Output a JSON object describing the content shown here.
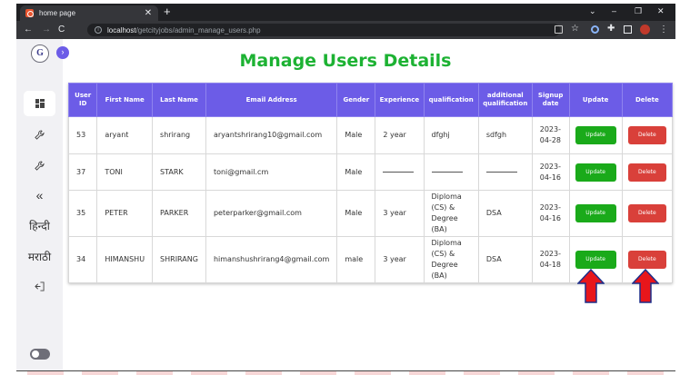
{
  "browser": {
    "tab_title": "home page",
    "url_host": "localhost",
    "url_path": "/getcityjobs/admin_manage_users.php"
  },
  "sidebar": {
    "logo_text": "G",
    "items": [
      {
        "icon": "dashboard-icon"
      },
      {
        "icon": "wrench-icon"
      },
      {
        "icon": "wrench-icon"
      },
      {
        "icon": "double-chevron-left-icon",
        "label": "«"
      },
      {
        "label": "हिन्दी"
      },
      {
        "label": "मराठी"
      },
      {
        "icon": "logout-icon"
      }
    ]
  },
  "page": {
    "title": "Manage Users Details"
  },
  "table": {
    "headers": [
      "User ID",
      "First Name",
      "Last Name",
      "Email Address",
      "Gender",
      "Experience",
      "qualification",
      "additional qualification",
      "Signup date",
      "Update",
      "Delete"
    ],
    "rows": [
      {
        "id": "53",
        "first": "aryant",
        "last": "shrirang",
        "email": "aryantshrirang10@gmail.com",
        "gender": "Male",
        "experience": "2 year",
        "qualification": "dfghj",
        "additional": "sdfgh",
        "signup": "2023-04-28"
      },
      {
        "id": "37",
        "first": "TONI",
        "last": "STARK",
        "email": "toni@gmail.cm",
        "gender": "Male",
        "experience": "",
        "qualification": "",
        "additional": "",
        "signup": "2023-04-16"
      },
      {
        "id": "35",
        "first": "PETER",
        "last": "PARKER",
        "email": "peterparker@gmail.com",
        "gender": "Male",
        "experience": "3 year",
        "qualification": "Diploma (CS) & Degree (BA)",
        "additional": "DSA",
        "signup": "2023-04-16"
      },
      {
        "id": "34",
        "first": "HIMANSHU",
        "last": "SHRIRANG",
        "email": "himanshushrirang4@gmail.com",
        "gender": "male",
        "experience": "3 year",
        "qualification": "Diploma (CS) & Degree (BA)",
        "additional": "DSA",
        "signup": "2023-04-18"
      }
    ],
    "update_label": "Update",
    "delete_label": "Delete"
  },
  "colors": {
    "title_green": "#1db233",
    "header_purple": "#6c5ce7",
    "update_green": "#1aaa1a",
    "delete_red": "#d9403a",
    "arrow_red": "#e8161b",
    "arrow_outline": "#1d2f8a"
  }
}
